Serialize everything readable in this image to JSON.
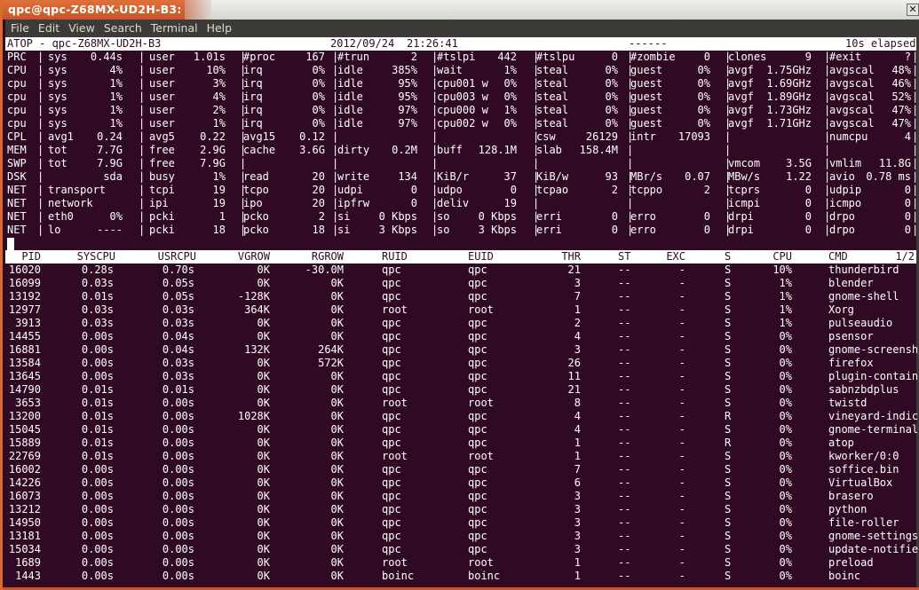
{
  "window": {
    "title": "qpc@qpc-Z68MX-UD2H-B3: ~",
    "close_icon": "close-x-icon",
    "accent": "#d96b2f",
    "terminal_bg": "#300a24"
  },
  "menu": [
    "File",
    "Edit",
    "View",
    "Search",
    "Terminal",
    "Help"
  ],
  "atop_header": {
    "app": "ATOP - qpc-Z68MX-UD2H-B3",
    "date": "2012/09/24",
    "time": "21:26:41",
    "marker": "------",
    "elapsed": "10s elapsed"
  },
  "system_lines": [
    {
      "label": "PRC",
      "cols": [
        [
          "sys",
          "0.44s"
        ],
        [
          "user",
          "1.01s"
        ],
        [
          "#proc",
          "167"
        ],
        [
          "#trun",
          "2"
        ],
        [
          "#tslpi",
          "442"
        ],
        [
          "#tslpu",
          "0"
        ],
        [
          "#zombie",
          "0"
        ],
        [
          "clones",
          "9"
        ],
        [
          "#exit",
          "?"
        ]
      ]
    },
    {
      "label": "CPU",
      "cols": [
        [
          "sys",
          "4%"
        ],
        [
          "user",
          "10%"
        ],
        [
          "irq",
          "0%"
        ],
        [
          "idle",
          "385%"
        ],
        [
          "wait",
          "1%"
        ],
        [
          "steal",
          "0%"
        ],
        [
          "guest",
          "0%"
        ],
        [
          "avgf",
          "1.75GHz"
        ],
        [
          "avgscal",
          "48%"
        ]
      ]
    },
    {
      "label": "cpu",
      "cols": [
        [
          "sys",
          "1%"
        ],
        [
          "user",
          "3%"
        ],
        [
          "irq",
          "0%"
        ],
        [
          "idle",
          "95%"
        ],
        [
          "cpu001 w",
          "0%"
        ],
        [
          "steal",
          "0%"
        ],
        [
          "guest",
          "0%"
        ],
        [
          "avgf",
          "1.69GHz"
        ],
        [
          "avgscal",
          "46%"
        ]
      ]
    },
    {
      "label": "cpu",
      "cols": [
        [
          "sys",
          "1%"
        ],
        [
          "user",
          "4%"
        ],
        [
          "irq",
          "0%"
        ],
        [
          "idle",
          "95%"
        ],
        [
          "cpu003 w",
          "0%"
        ],
        [
          "steal",
          "0%"
        ],
        [
          "guest",
          "0%"
        ],
        [
          "avgf",
          "1.89GHz"
        ],
        [
          "avgscal",
          "52%"
        ]
      ]
    },
    {
      "label": "cpu",
      "cols": [
        [
          "sys",
          "1%"
        ],
        [
          "user",
          "2%"
        ],
        [
          "irq",
          "0%"
        ],
        [
          "idle",
          "97%"
        ],
        [
          "cpu000 w",
          "1%"
        ],
        [
          "steal",
          "0%"
        ],
        [
          "guest",
          "0%"
        ],
        [
          "avgf",
          "1.73GHz"
        ],
        [
          "avgscal",
          "47%"
        ]
      ]
    },
    {
      "label": "cpu",
      "cols": [
        [
          "sys",
          "1%"
        ],
        [
          "user",
          "1%"
        ],
        [
          "irq",
          "0%"
        ],
        [
          "idle",
          "97%"
        ],
        [
          "cpu002 w",
          "0%"
        ],
        [
          "steal",
          "0%"
        ],
        [
          "guest",
          "0%"
        ],
        [
          "avgf",
          "1.71GHz"
        ],
        [
          "avgscal",
          "47%"
        ]
      ]
    },
    {
      "label": "CPL",
      "cols": [
        [
          "avg1",
          "0.24"
        ],
        [
          "avg5",
          "0.22"
        ],
        [
          "avg15",
          "0.12"
        ],
        [
          "",
          ""
        ],
        [
          "",
          ""
        ],
        [
          "csw",
          "26129"
        ],
        [
          "intr",
          "17093"
        ],
        [
          "",
          ""
        ],
        [
          "numcpu",
          "4"
        ]
      ]
    },
    {
      "label": "MEM",
      "cols": [
        [
          "tot",
          "7.7G"
        ],
        [
          "free",
          "2.9G"
        ],
        [
          "cache",
          "3.6G"
        ],
        [
          "dirty",
          "0.2M"
        ],
        [
          "buff",
          "128.1M"
        ],
        [
          "slab",
          "158.4M"
        ],
        [
          "",
          ""
        ],
        [
          "",
          ""
        ],
        [
          "",
          ""
        ]
      ]
    },
    {
      "label": "SWP",
      "cols": [
        [
          "tot",
          "7.9G"
        ],
        [
          "free",
          "7.9G"
        ],
        [
          "",
          ""
        ],
        [
          "",
          ""
        ],
        [
          "",
          ""
        ],
        [
          "",
          ""
        ],
        [
          "",
          ""
        ],
        [
          "vmcom",
          "3.5G"
        ],
        [
          "vmlim",
          "11.8G"
        ]
      ]
    },
    {
      "label": "DSK",
      "cols": [
        [
          "",
          "sda"
        ],
        [
          "busy",
          "1%"
        ],
        [
          "read",
          "20"
        ],
        [
          "write",
          "134"
        ],
        [
          "KiB/r",
          "37"
        ],
        [
          "KiB/w",
          "93"
        ],
        [
          "MBr/s",
          "0.07"
        ],
        [
          "MBw/s",
          "1.22"
        ],
        [
          "avio",
          "0.78 ms"
        ]
      ]
    },
    {
      "label": "NET",
      "cols": [
        [
          "transport",
          ""
        ],
        [
          "tcpi",
          "19"
        ],
        [
          "tcpo",
          "20"
        ],
        [
          "udpi",
          "0"
        ],
        [
          "udpo",
          "0"
        ],
        [
          "tcpao",
          "2"
        ],
        [
          "tcppo",
          "2"
        ],
        [
          "tcprs",
          "0"
        ],
        [
          "udpip",
          "0"
        ]
      ]
    },
    {
      "label": "NET",
      "cols": [
        [
          "network",
          ""
        ],
        [
          "ipi",
          "19"
        ],
        [
          "ipo",
          "20"
        ],
        [
          "ipfrw",
          "0"
        ],
        [
          "deliv",
          "19"
        ],
        [
          "",
          ""
        ],
        [
          "",
          ""
        ],
        [
          "icmpi",
          "0"
        ],
        [
          "icmpo",
          "0"
        ]
      ]
    },
    {
      "label": "NET",
      "cols": [
        [
          "eth0",
          "0%"
        ],
        [
          "pcki",
          "1"
        ],
        [
          "pcko",
          "2"
        ],
        [
          "si",
          "0 Kbps"
        ],
        [
          "so",
          "0 Kbps"
        ],
        [
          "erri",
          "0"
        ],
        [
          "erro",
          "0"
        ],
        [
          "drpi",
          "0"
        ],
        [
          "drpo",
          "0"
        ]
      ]
    },
    {
      "label": "NET",
      "cols": [
        [
          "lo",
          "----"
        ],
        [
          "pcki",
          "18"
        ],
        [
          "pcko",
          "18"
        ],
        [
          "si",
          "3 Kbps"
        ],
        [
          "so",
          "3 Kbps"
        ],
        [
          "erri",
          "0"
        ],
        [
          "erro",
          "0"
        ],
        [
          "drpi",
          "0"
        ],
        [
          "drpo",
          "0"
        ]
      ]
    }
  ],
  "process_table": {
    "headers": [
      "PID",
      "SYSCPU",
      "USRCPU",
      "VGROW",
      "RGROW",
      "RUID",
      "EUID",
      "THR",
      "ST",
      "EXC",
      "S",
      "CPU",
      "CMD"
    ],
    "page": "1/2",
    "rows": [
      [
        "16020",
        "0.28s",
        "0.70s",
        "0K",
        "-30.0M",
        "qpc",
        "qpc",
        "21",
        "--",
        "-",
        "S",
        "10%",
        "thunderbird"
      ],
      [
        "16099",
        "0.03s",
        "0.05s",
        "0K",
        "0K",
        "qpc",
        "qpc",
        "3",
        "--",
        "-",
        "S",
        "1%",
        "blender"
      ],
      [
        "13192",
        "0.01s",
        "0.05s",
        "-128K",
        "0K",
        "qpc",
        "qpc",
        "7",
        "--",
        "-",
        "S",
        "1%",
        "gnome-shell"
      ],
      [
        "12977",
        "0.03s",
        "0.03s",
        "364K",
        "0K",
        "root",
        "root",
        "1",
        "--",
        "-",
        "S",
        "1%",
        "Xorg"
      ],
      [
        "3913",
        "0.03s",
        "0.03s",
        "0K",
        "0K",
        "qpc",
        "qpc",
        "2",
        "--",
        "-",
        "S",
        "1%",
        "pulseaudio"
      ],
      [
        "14455",
        "0.00s",
        "0.04s",
        "0K",
        "0K",
        "qpc",
        "qpc",
        "4",
        "--",
        "-",
        "S",
        "0%",
        "psensor"
      ],
      [
        "16881",
        "0.00s",
        "0.04s",
        "132K",
        "264K",
        "qpc",
        "qpc",
        "3",
        "--",
        "-",
        "S",
        "0%",
        "gnome-screensh"
      ],
      [
        "13584",
        "0.00s",
        "0.03s",
        "0K",
        "572K",
        "qpc",
        "qpc",
        "26",
        "--",
        "-",
        "S",
        "0%",
        "firefox"
      ],
      [
        "13645",
        "0.00s",
        "0.03s",
        "0K",
        "0K",
        "qpc",
        "qpc",
        "11",
        "--",
        "-",
        "S",
        "0%",
        "plugin-contain"
      ],
      [
        "14790",
        "0.01s",
        "0.01s",
        "0K",
        "0K",
        "qpc",
        "qpc",
        "21",
        "--",
        "-",
        "S",
        "0%",
        "sabnzbdplus"
      ],
      [
        "3653",
        "0.01s",
        "0.00s",
        "0K",
        "0K",
        "root",
        "root",
        "8",
        "--",
        "-",
        "S",
        "0%",
        "twistd"
      ],
      [
        "13200",
        "0.01s",
        "0.00s",
        "1028K",
        "0K",
        "qpc",
        "qpc",
        "4",
        "--",
        "-",
        "R",
        "0%",
        "vineyard-indic"
      ],
      [
        "15045",
        "0.01s",
        "0.00s",
        "0K",
        "0K",
        "qpc",
        "qpc",
        "4",
        "--",
        "-",
        "S",
        "0%",
        "gnome-terminal"
      ],
      [
        "15889",
        "0.01s",
        "0.00s",
        "0K",
        "0K",
        "qpc",
        "qpc",
        "1",
        "--",
        "-",
        "R",
        "0%",
        "atop"
      ],
      [
        "22769",
        "0.01s",
        "0.00s",
        "0K",
        "0K",
        "root",
        "root",
        "1",
        "--",
        "-",
        "S",
        "0%",
        "kworker/0:0"
      ],
      [
        "16002",
        "0.00s",
        "0.00s",
        "0K",
        "0K",
        "qpc",
        "qpc",
        "7",
        "--",
        "-",
        "S",
        "0%",
        "soffice.bin"
      ],
      [
        "14226",
        "0.00s",
        "0.00s",
        "0K",
        "0K",
        "qpc",
        "qpc",
        "6",
        "--",
        "-",
        "S",
        "0%",
        "VirtualBox"
      ],
      [
        "16073",
        "0.00s",
        "0.00s",
        "0K",
        "0K",
        "qpc",
        "qpc",
        "3",
        "--",
        "-",
        "S",
        "0%",
        "brasero"
      ],
      [
        "13212",
        "0.00s",
        "0.00s",
        "0K",
        "0K",
        "qpc",
        "qpc",
        "3",
        "--",
        "-",
        "S",
        "0%",
        "python"
      ],
      [
        "14950",
        "0.00s",
        "0.00s",
        "0K",
        "0K",
        "qpc",
        "qpc",
        "3",
        "--",
        "-",
        "S",
        "0%",
        "file-roller"
      ],
      [
        "13181",
        "0.00s",
        "0.00s",
        "0K",
        "0K",
        "qpc",
        "qpc",
        "3",
        "--",
        "-",
        "S",
        "0%",
        "gnome-settings"
      ],
      [
        "15034",
        "0.00s",
        "0.00s",
        "0K",
        "0K",
        "qpc",
        "qpc",
        "3",
        "--",
        "-",
        "S",
        "0%",
        "update-notifie"
      ],
      [
        "1689",
        "0.00s",
        "0.00s",
        "0K",
        "0K",
        "root",
        "root",
        "1",
        "--",
        "-",
        "S",
        "0%",
        "preload"
      ],
      [
        "1443",
        "0.00s",
        "0.00s",
        "0K",
        "0K",
        "boinc",
        "boinc",
        "1",
        "--",
        "-",
        "S",
        "0%",
        "boinc"
      ]
    ]
  }
}
